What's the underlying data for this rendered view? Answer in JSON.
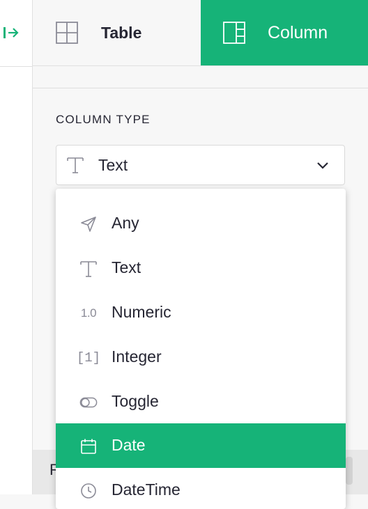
{
  "tabs": [
    {
      "label": "Table",
      "icon": "table-grid-icon",
      "active": false
    },
    {
      "label": "Column",
      "icon": "column-layout-icon",
      "active": true
    }
  ],
  "column_type": {
    "section_label": "COLUMN TYPE",
    "selected_value": "Text",
    "selected_icon": "text-type-icon"
  },
  "dropdown": {
    "options": [
      {
        "label": "Any",
        "icon": "send-arrow-icon",
        "glyph": ""
      },
      {
        "label": "Text",
        "icon": "text-type-icon",
        "glyph": ""
      },
      {
        "label": "Numeric",
        "icon": "numeric-icon",
        "glyph": "1.0"
      },
      {
        "label": "Integer",
        "icon": "integer-icon",
        "glyph": "[1]"
      },
      {
        "label": "Toggle",
        "icon": "toggle-icon",
        "glyph": ""
      },
      {
        "label": "Date",
        "icon": "calendar-icon",
        "glyph": "",
        "highlighted": true
      },
      {
        "label": "DateTime",
        "icon": "clock-icon",
        "glyph": ""
      }
    ]
  },
  "bottom_peek": {
    "text": "R"
  },
  "colors": {
    "accent": "#16b378",
    "background": "#f7f7f7",
    "text": "#262633",
    "icon_gray": "#8a8a96"
  }
}
